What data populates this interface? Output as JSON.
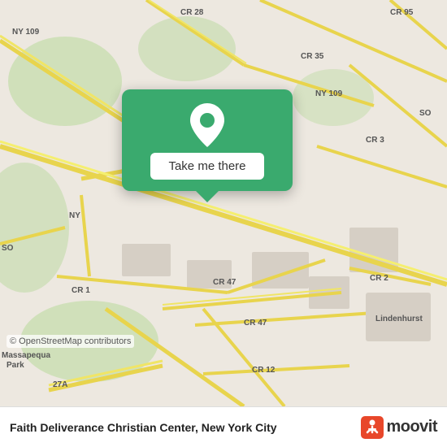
{
  "map": {
    "background_color": "#e8e0d8",
    "attribution": "© OpenStreetMap contributors"
  },
  "popup": {
    "button_label": "Take me there",
    "background_color": "#3aaa6e"
  },
  "bottom_bar": {
    "place_name": "Faith Deliverance Christian Center, New York City",
    "moovit_label": "moovit"
  }
}
